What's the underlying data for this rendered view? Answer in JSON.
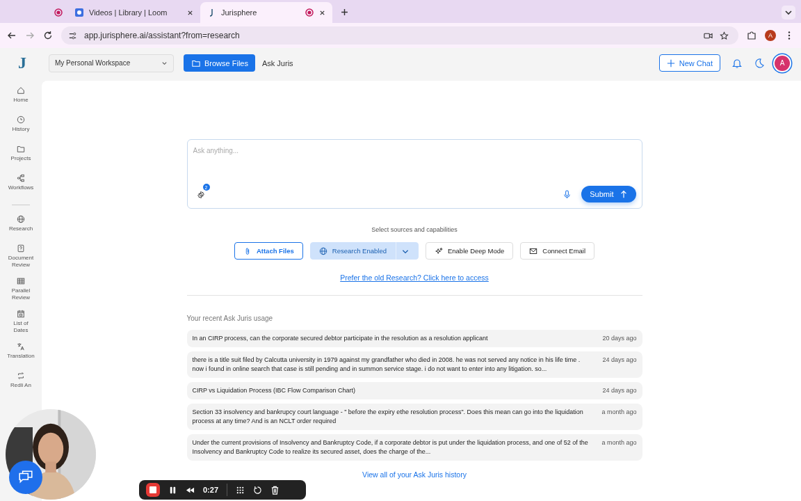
{
  "browser": {
    "tabs": [
      {
        "kind": "recording",
        "selected": false
      },
      {
        "kind": "loom",
        "title": "Videos | Library | Loom",
        "selected": false
      },
      {
        "kind": "site",
        "title": "Jurisphere",
        "selected": true
      }
    ],
    "address": "app.jurisphere.ai/assistant?from=research",
    "profile": "A"
  },
  "header": {
    "workspace": "My Personal Workspace",
    "browse_button": "Browse Files",
    "page_title": "Ask Juris",
    "new_chat": "New Chat",
    "avatar": "A",
    "logo": "J"
  },
  "sidebar": {
    "items": [
      {
        "label": "Home"
      },
      {
        "label": "History"
      },
      {
        "label": "Projects"
      },
      {
        "label": "Workflows"
      },
      {
        "label": "Research"
      },
      {
        "label": "Document Review"
      },
      {
        "label": "Parallel Review"
      },
      {
        "label": "List of Dates"
      },
      {
        "label": "Translation"
      },
      {
        "label": "Redli An"
      }
    ]
  },
  "query": {
    "placeholder": "Ask anything...",
    "settings_badge": "2",
    "submit": "Submit"
  },
  "sources": {
    "label": "Select sources and capabilities",
    "options": [
      {
        "kind": "attach",
        "label": "Attach Files",
        "selected": false
      },
      {
        "kind": "research",
        "label": "Research Enabled",
        "selected": true
      },
      {
        "kind": "deep",
        "label": "Enable Deep Mode",
        "selected": false
      },
      {
        "kind": "email",
        "label": "Connect Email",
        "selected": false
      }
    ]
  },
  "old_research_link": "Prefer the old Research? Click here to access",
  "recent": {
    "title": "Your recent Ask Juris usage",
    "items": [
      {
        "text": "In an CIRP process, can the corporate secured debtor participate in the resolution as a resolution applicant",
        "time": "20 days ago"
      },
      {
        "text": "there is a title suit filed by Calcutta university in 1979 against my grandfather who died in 2008. he was not served any notice in his life time . now i found in online search that case is still pending and in summon service stage. i do not want to enter into any litigation. so...",
        "time": "24 days ago"
      },
      {
        "text": "CIRP vs Liquidation Process (IBC Flow Comparison Chart)",
        "time": "24 days ago"
      },
      {
        "text": "Section 33 insolvency and bankrupcy court language - \" before the expiry ethe resolution process\". Does this mean can go into the liquidation process at any time? And is an NCLT order required",
        "time": "a month ago"
      },
      {
        "text": "Under the current provisions of Insolvency and Bankruptcy Code, if a corporate debtor is put under the liquidation process, and one of 52 of the Insolvency and Bankruptcy Code to realize its secured asset, does the charge of the...",
        "time": "a month ago"
      }
    ]
  },
  "view_all": "View all of your Ask Juris history",
  "recorder": {
    "time": "0:27"
  }
}
